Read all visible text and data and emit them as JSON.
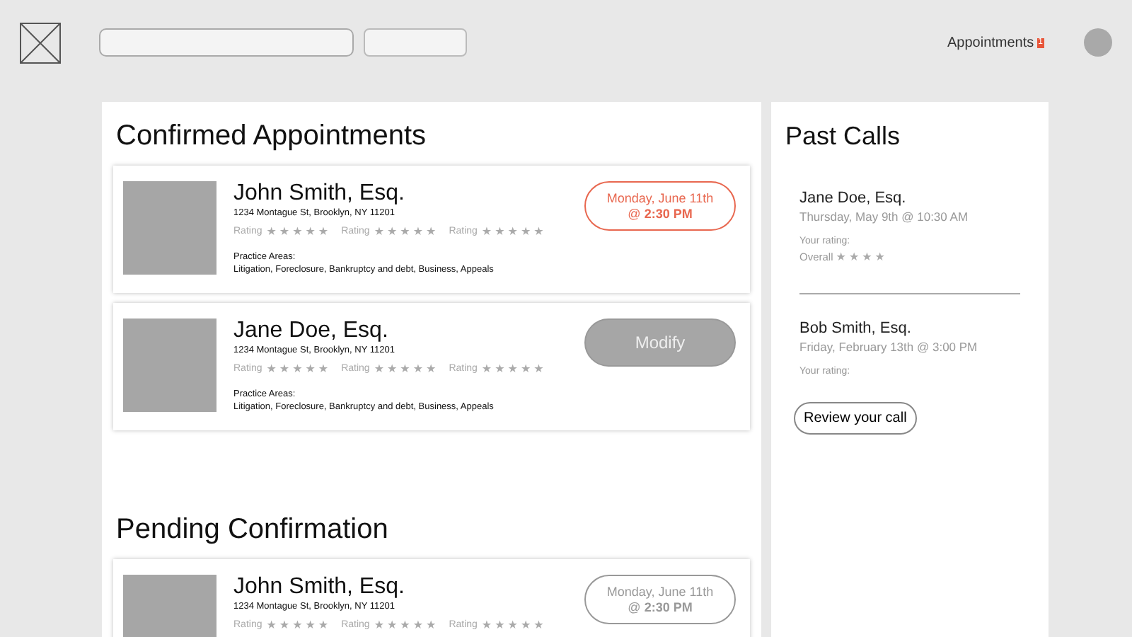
{
  "header": {
    "nav_link": "Appointments",
    "badge": "1"
  },
  "sections": [
    {
      "title": "Confirmed Appointments",
      "cards": [
        {
          "name": "John Smith, Esq.",
          "address": "1234 Montague St, Brooklyn, NY 11201",
          "ratings": [
            {
              "label": "Rating",
              "star_glyphs": "★★★★★"
            },
            {
              "label": "Rating",
              "star_glyphs": "★★★★★"
            },
            {
              "label": "Rating",
              "star_glyphs": "★★★★★"
            }
          ],
          "practice_label": "Practice Areas:",
          "practice_areas": "Litigation, Foreclosure, Bankruptcy and debt, Business, Appeals",
          "action": {
            "kind": "date",
            "highlighted": true,
            "lines": [
              "Monday, June 11th",
              "@ **2:30 PM**"
            ]
          }
        },
        {
          "name": "Jane Doe, Esq.",
          "address": "1234 Montague St, Brooklyn, NY 11201",
          "ratings": [
            {
              "label": "Rating",
              "star_glyphs": "★★★★★"
            },
            {
              "label": "Rating",
              "star_glyphs": "★★★★★"
            },
            {
              "label": "Rating",
              "star_glyphs": "★★★★★"
            }
          ],
          "practice_label": "Practice Areas:",
          "practice_areas": "Litigation, Foreclosure, Bankruptcy and debt, Business, Appeals",
          "action": {
            "kind": "button",
            "label": "Modify"
          }
        }
      ]
    },
    {
      "title": "Pending Confirmation",
      "cards": [
        {
          "name": "John Smith, Esq.",
          "address": "1234 Montague St, Brooklyn, NY 11201",
          "ratings": [
            {
              "label": "Rating",
              "star_glyphs": "★★★★★"
            },
            {
              "label": "Rating",
              "star_glyphs": "★★★★★"
            },
            {
              "label": "Rating",
              "star_glyphs": "★★★★★"
            }
          ],
          "action": {
            "kind": "date",
            "highlighted": false,
            "lines": [
              "Monday, June 11th",
              "@ **2:30 PM**"
            ]
          }
        }
      ]
    }
  ],
  "past_calls": {
    "title": "Past Calls",
    "calls": [
      {
        "name": "Jane Doe, Esq.",
        "date": "Thursday, May 9th @ 10:30 AM",
        "rating_label": "Your rating:",
        "overall": {
          "label": "Overall",
          "star_glyphs": "★★★★"
        }
      },
      {
        "name": "Bob Smith, Esq.",
        "date": "Friday, February 13th @ 3:00 PM",
        "rating_label": "Your rating:"
      }
    ],
    "button": "Review your call"
  }
}
